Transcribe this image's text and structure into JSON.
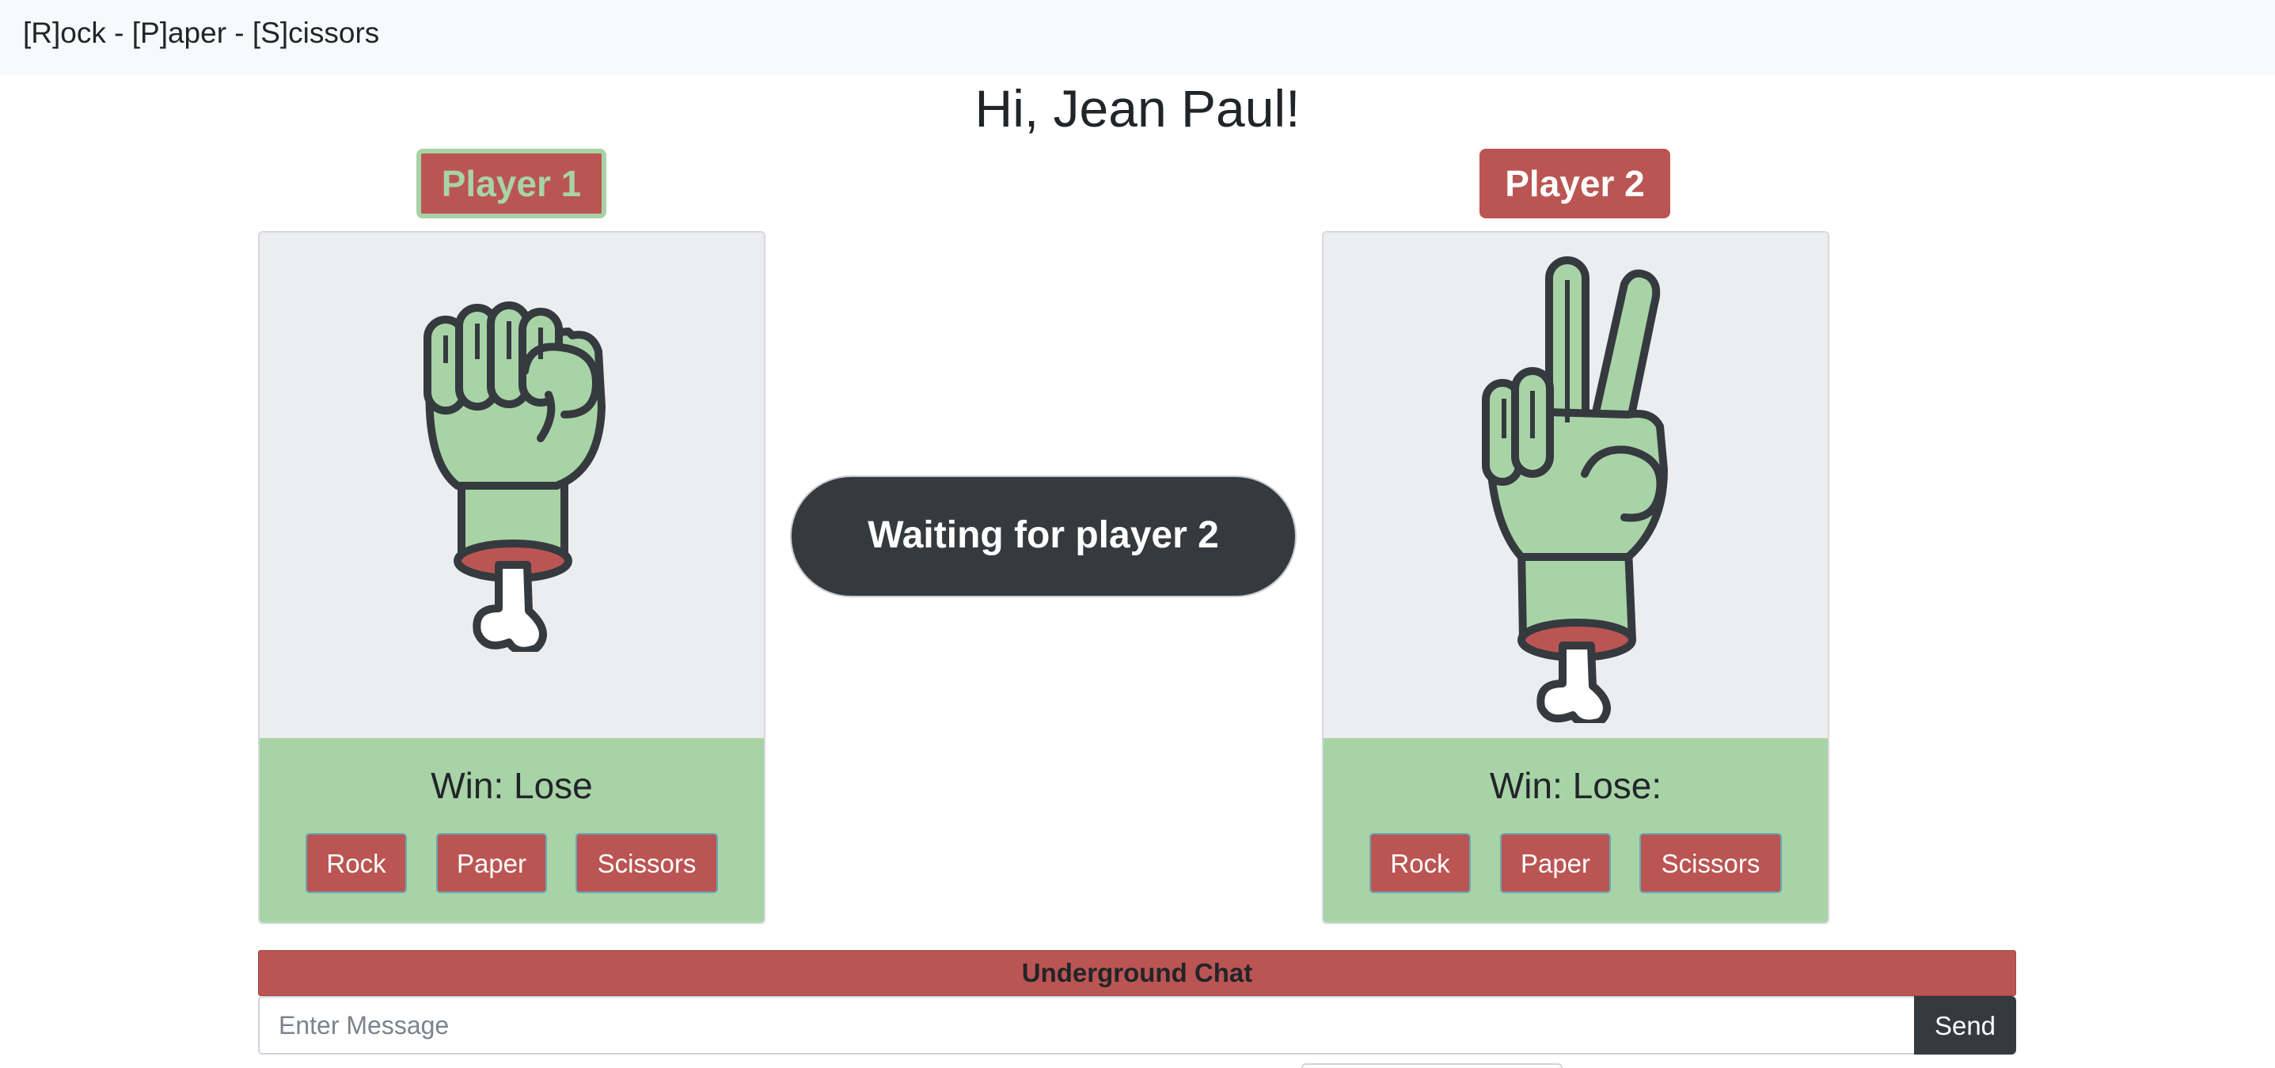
{
  "navbar": {
    "brand": "[R]ock - [P]aper - [S]cissors"
  },
  "greeting": "Hi, Jean Paul!",
  "players": [
    {
      "badge": "Player 1",
      "score": "Win: Lose",
      "hand": "fist-hand-icon",
      "buttons": [
        "Rock",
        "Paper",
        "Scissors"
      ]
    },
    {
      "badge": "Player 2",
      "score": "Win: Lose:",
      "hand": "peace-hand-icon",
      "buttons": [
        "Rock",
        "Paper",
        "Scissors"
      ]
    }
  ],
  "status": "Waiting for player 2",
  "chat": {
    "title": "Underground Chat",
    "placeholder": "Enter Message",
    "send_label": "Send"
  },
  "colors": {
    "accent_red": "#bb5553",
    "accent_green": "#a8d3a7",
    "dark": "#353a3f"
  }
}
